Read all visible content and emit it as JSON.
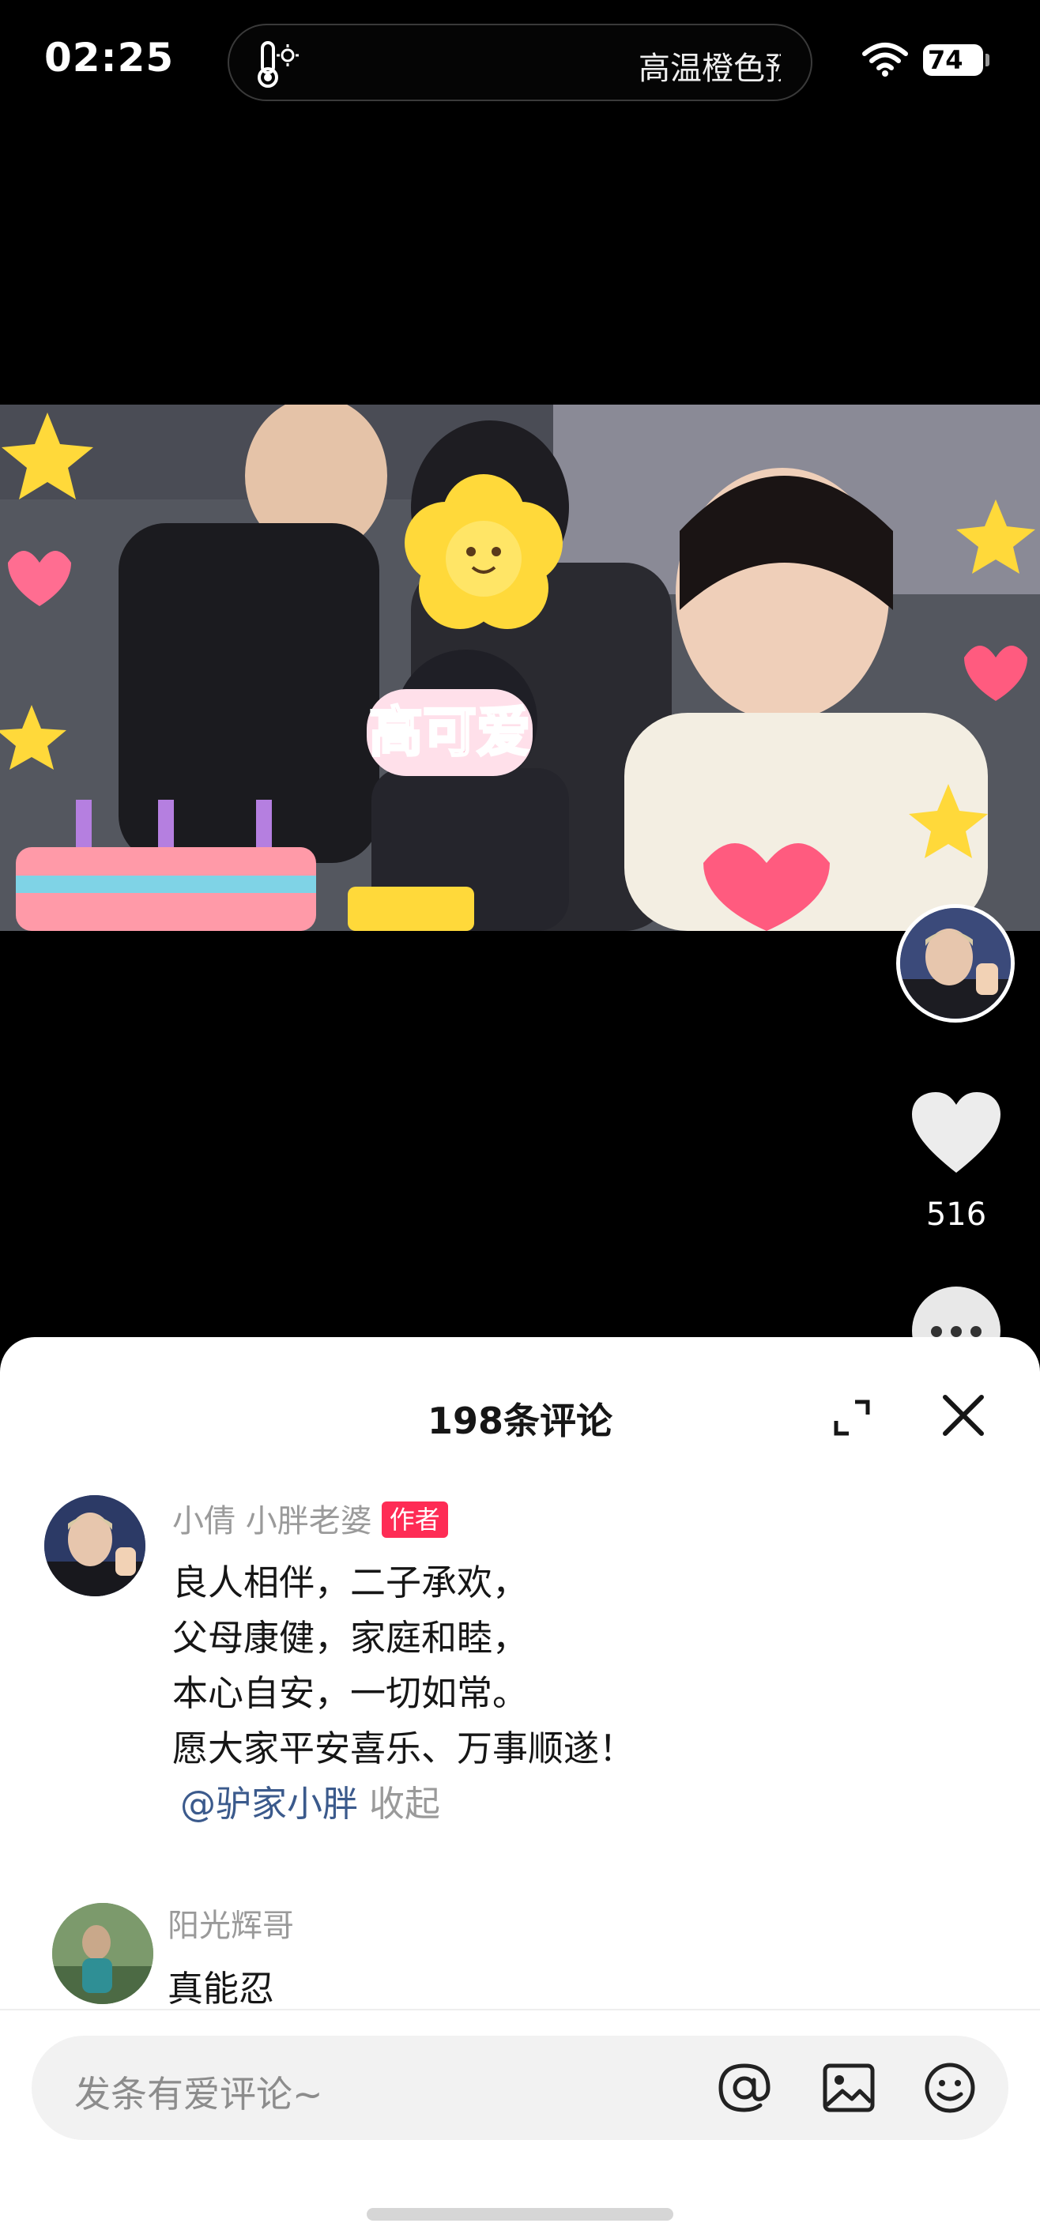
{
  "status_bar": {
    "time": "02:25",
    "island_text": "高温橙色预",
    "battery": "74"
  },
  "video": {
    "sticker_text": "高可爱"
  },
  "right_rail": {
    "like_count": "516"
  },
  "comments_sheet": {
    "title": "198条评论",
    "comments": [
      {
        "user": "小倩 小胖老婆",
        "badge": "作者",
        "lines": [
          "良人相伴，二子承欢，",
          "父母康健，家庭和睦，",
          "本心自安，一切如常。",
          "愿大家平安喜乐、万事顺遂！"
        ],
        "mention": "@驴家小胖",
        "collapse": "收起"
      },
      {
        "user": "阳光辉哥",
        "text": "真能忍"
      }
    ],
    "input_placeholder": "发条有爱评论~"
  },
  "colors": {
    "accent_red": "#fe2c55",
    "mention_blue": "#3b5a8c"
  }
}
